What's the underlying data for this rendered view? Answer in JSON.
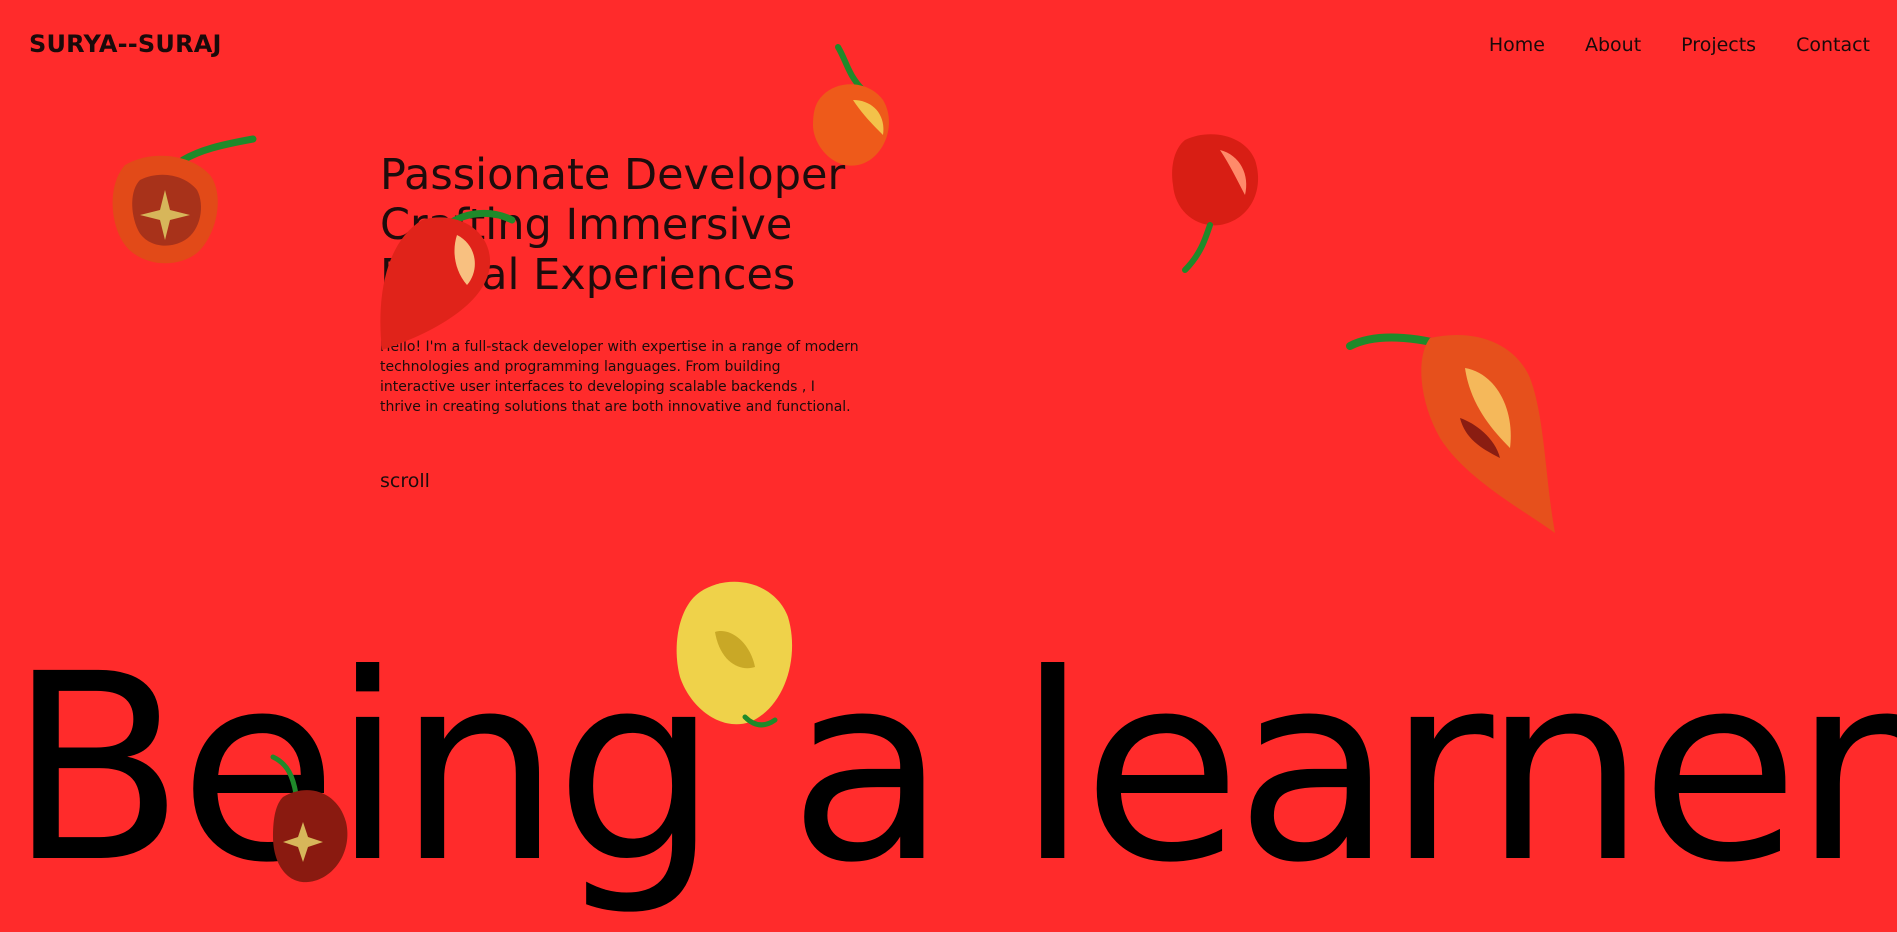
{
  "brand": "SURYA--SURAJ",
  "nav": {
    "home": "Home",
    "about": "About",
    "projects": "Projects",
    "contact": "Contact"
  },
  "hero": {
    "headline": "Passionate Developer Crafting Immersive Digital Experiences",
    "intro": "Hello! I'm a full-stack developer with expertise in a range of modern technologies and programming languages. From building interactive user interfaces to developing scalable backends , I thrive in creating solutions that are both innovative and functional.",
    "scroll": "scroll"
  },
  "marquee": "Being a learner",
  "colors": {
    "background": "#ff2b2b",
    "text": "#111111",
    "stem": "#1f8a2a"
  },
  "icons": [
    "pepper-icon"
  ]
}
